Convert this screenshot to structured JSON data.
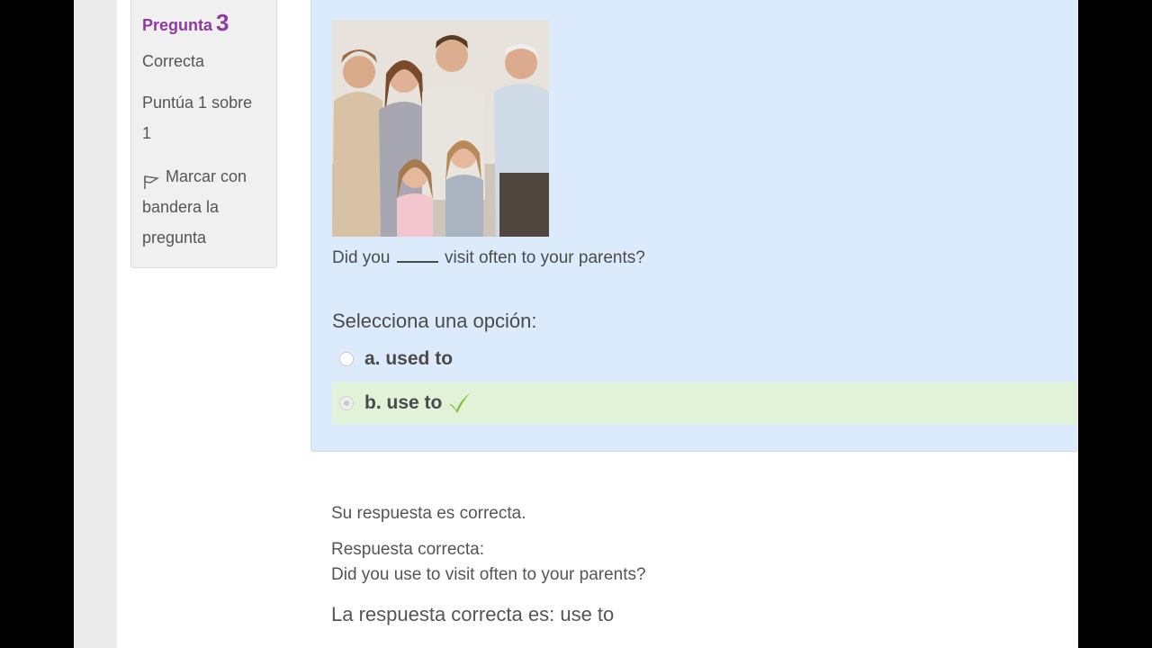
{
  "info": {
    "question_label": "Pregunta",
    "question_number": "3",
    "state": "Correcta",
    "grade_line1": "Puntúa 1 sobre",
    "grade_line2": "1",
    "flag_line1": "Marcar con",
    "flag_line2": "bandera la",
    "flag_line3": "pregunta"
  },
  "question": {
    "text_before": "Did you",
    "text_after": "visit often to your parents?",
    "prompt": "Selecciona una opción:",
    "options": [
      {
        "label": "a. used to",
        "checked": false,
        "correct": false
      },
      {
        "label": "b. use to",
        "checked": true,
        "correct": true
      }
    ]
  },
  "feedback": {
    "general": "Su respuesta es correcta.",
    "right_answer_title": "Respuesta correcta:",
    "right_answer_sentence": "Did you use to visit often to your parents?",
    "right_answer": "La respuesta correcta es: use to"
  },
  "colors": {
    "accent": "#8e3aa0",
    "question_bg": "#dcebfb",
    "correct_bg": "#e2f2d9",
    "check": "#7cc13f"
  },
  "icons": [
    "flag-icon",
    "checkmark-icon"
  ]
}
